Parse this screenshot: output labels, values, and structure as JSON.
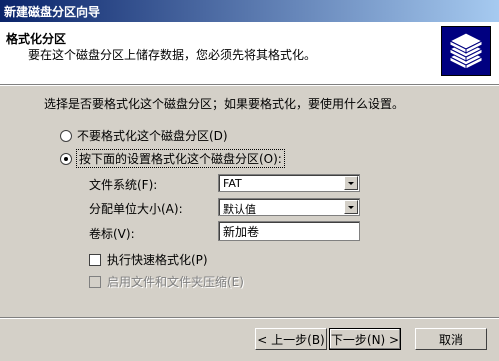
{
  "window": {
    "title": "新建磁盘分区向导"
  },
  "header": {
    "title": "格式化分区",
    "subtitle": "要在这个磁盘分区上储存数据，您必须先将其格式化。",
    "icon": "disk-stack-icon"
  },
  "prompt": "选择是否要格式化这个磁盘分区；如果要格式化，要使用什么设置。",
  "options": {
    "no_format": {
      "label": "不要格式化这个磁盘分区(D)",
      "selected": false
    },
    "format": {
      "label": "按下面的设置格式化这个磁盘分区(O):",
      "selected": true
    }
  },
  "fields": {
    "filesystem": {
      "label": "文件系统(F):",
      "value": "FAT"
    },
    "allocation_unit": {
      "label": "分配单位大小(A):",
      "value": "默认值"
    },
    "volume_label": {
      "label": "卷标(V):",
      "value": "新加卷"
    }
  },
  "checkboxes": {
    "quick_format": {
      "label": "执行快速格式化(P)",
      "checked": false,
      "enabled": true
    },
    "compression": {
      "label": "启用文件和文件夹压缩(E)",
      "checked": false,
      "enabled": false
    }
  },
  "buttons": {
    "back": "< 上一步(B)",
    "next": "下一步(N) >",
    "cancel": "取消"
  },
  "colors": {
    "titlebar_start": "#0a246a",
    "titlebar_end": "#a6caf0",
    "dialog_bg": "#d4d0c8",
    "icon_bg": "#000080"
  }
}
